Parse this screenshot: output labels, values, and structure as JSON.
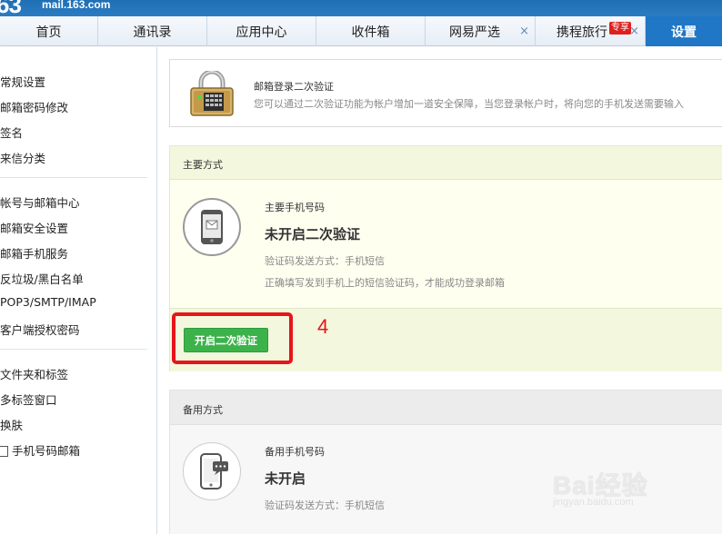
{
  "header": {
    "logo_number": "63",
    "logo_domain": "mail.163.com"
  },
  "tabs": [
    {
      "label": "首页"
    },
    {
      "label": "通讯录"
    },
    {
      "label": "应用中心"
    },
    {
      "label": "收件箱"
    },
    {
      "label": "网易严选",
      "close": "×"
    },
    {
      "label": "携程旅行",
      "badge": "专享",
      "close": "×"
    },
    {
      "label": "设置"
    }
  ],
  "sidebar": {
    "group1": [
      "常规设置",
      "邮箱密码修改",
      "签名",
      "来信分类"
    ],
    "group2": [
      "帐号与邮箱中心",
      "邮箱安全设置",
      "邮箱手机服务",
      "反垃圾/黑白名单",
      "POP3/SMTP/IMAP",
      "客户端授权密码"
    ],
    "group3": [
      "文件夹和标签",
      "多标签窗口",
      "换肤",
      "手机号码邮箱"
    ]
  },
  "intro": {
    "title": "邮箱登录二次验证",
    "description": "您可以通过二次验证功能为帐户增加一道安全保障，当您登录帐户时，将向您的手机发送需要输入"
  },
  "primary": {
    "section_title": "主要方式",
    "label": "主要手机号码",
    "status": "未开启二次验证",
    "method": "验证码发送方式：手机短信",
    "instruction": "正确填写发到手机上的短信验证码，才能成功登录邮箱",
    "button": "开启二次验证"
  },
  "annotation": {
    "step": "4",
    "highlight_color": "#e8141a"
  },
  "backup": {
    "section_title": "备用方式",
    "label": "备用手机号码",
    "status": "未开启",
    "method": "验证码发送方式：手机短信"
  },
  "watermark": {
    "text": "Bai经验",
    "url": "jingyan.baidu.com"
  },
  "colors": {
    "header_blue": "#1f77c5",
    "green_button": "#3cb34a",
    "primary_bg": "#fffff0"
  }
}
